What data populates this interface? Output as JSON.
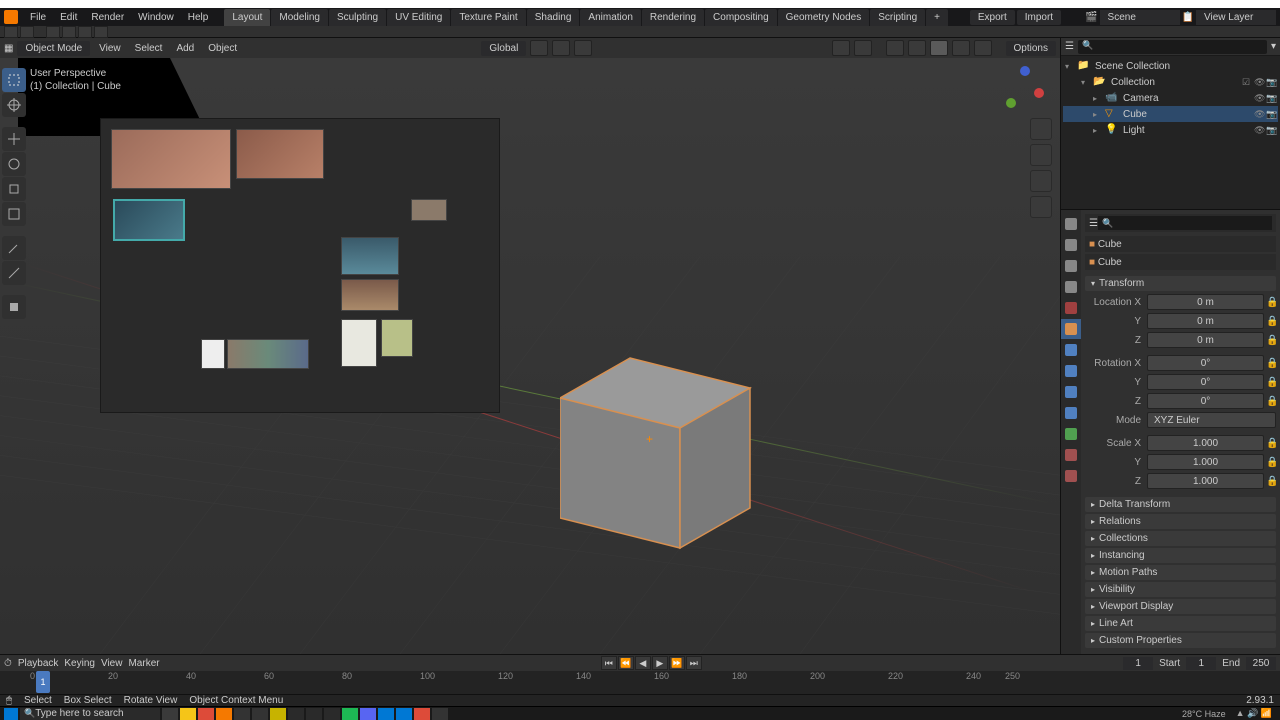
{
  "app": {
    "name": "Blender"
  },
  "menu": {
    "items": [
      "File",
      "Edit",
      "Render",
      "Window",
      "Help"
    ]
  },
  "workspaces": {
    "tabs": [
      "Layout",
      "Modeling",
      "Sculpting",
      "UV Editing",
      "Texture Paint",
      "Shading",
      "Animation",
      "Rendering",
      "Compositing",
      "Geometry Nodes",
      "Scripting"
    ],
    "active": 0
  },
  "topbar": {
    "export": "Export",
    "import": "Import",
    "scene_label": "Scene",
    "scene": "Scene",
    "viewlayer_label": "ViewLayer",
    "viewlayer": "View Layer"
  },
  "viewport": {
    "mode": "Object Mode",
    "menus": [
      "View",
      "Select",
      "Add",
      "Object"
    ],
    "global": "Global",
    "options": "Options",
    "hud_line1": "User Perspective",
    "hud_line2": "(1) Collection | Cube"
  },
  "outliner": {
    "title": "Scene Collection",
    "items": [
      {
        "label": "Collection",
        "indent": 1,
        "expanded": true
      },
      {
        "label": "Camera",
        "indent": 2,
        "icon": "camera"
      },
      {
        "label": "Cube",
        "indent": 2,
        "icon": "mesh",
        "selected": true
      },
      {
        "label": "Light",
        "indent": 2,
        "icon": "light"
      }
    ]
  },
  "props": {
    "object_name": "Cube",
    "data_name": "Cube",
    "transform_hdr": "Transform",
    "loc_label": "Location X",
    "loc_x": "0 m",
    "loc_y": "0 m",
    "loc_z": "0 m",
    "rot_label": "Rotation X",
    "rot_x": "0°",
    "rot_y": "0°",
    "rot_z": "0°",
    "mode_label": "Mode",
    "rot_mode": "XYZ Euler",
    "scale_label": "Scale X",
    "scale_x": "1.000",
    "scale_y": "1.000",
    "scale_z": "1.000",
    "y_label": "Y",
    "z_label": "Z",
    "sections": [
      "Delta Transform",
      "Relations",
      "Collections",
      "Instancing",
      "Motion Paths",
      "Visibility",
      "Viewport Display",
      "Line Art",
      "Custom Properties"
    ]
  },
  "timeline": {
    "playback": "Playback",
    "keying": "Keying",
    "view": "View",
    "marker": "Marker",
    "current": "1",
    "start_label": "Start",
    "start": "1",
    "end_label": "End",
    "end": "250",
    "ticks": [
      0,
      20,
      40,
      60,
      80,
      100,
      120,
      140,
      160,
      180,
      200,
      220,
      240,
      250
    ]
  },
  "status": {
    "select": "Select",
    "box": "Box Select",
    "rotate": "Rotate View",
    "context": "Object Context Menu",
    "version": "2.93.1"
  },
  "taskbar": {
    "search_ph": "Type here to search",
    "weather": "28°C Haze"
  }
}
